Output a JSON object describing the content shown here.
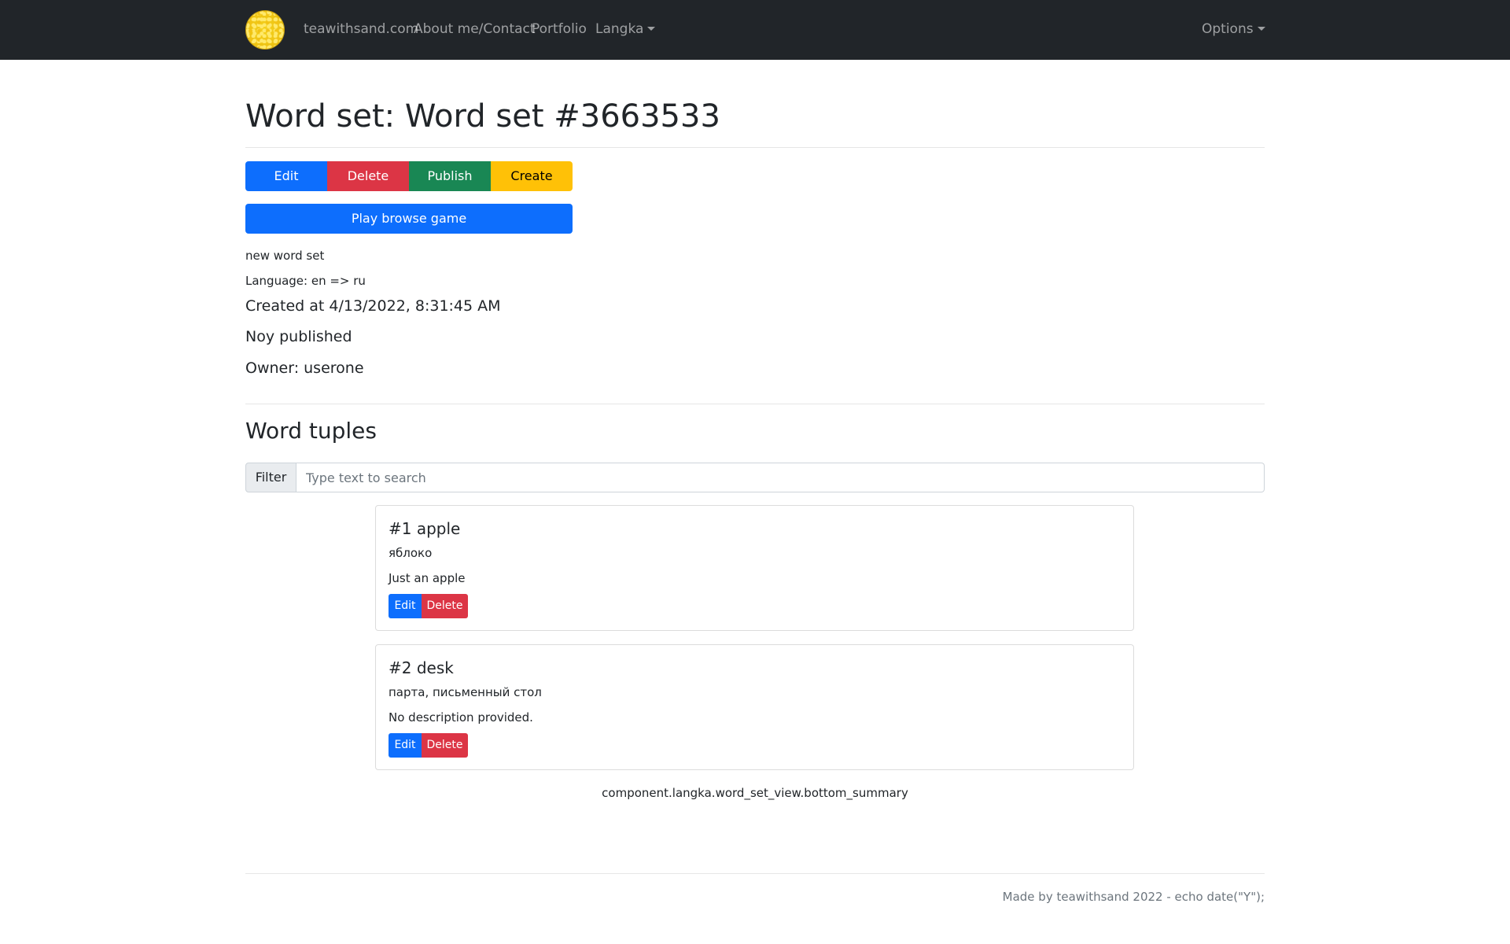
{
  "navbar": {
    "brand_icon": "sand-logo-icon",
    "links": [
      "teawithsand.com",
      "About me/Contact",
      "Portfolio"
    ],
    "dropdown_label": "Langka",
    "options_label": "Options"
  },
  "page": {
    "title": "Word set: Word set #3663533"
  },
  "actions": {
    "edit": "Edit",
    "delete": "Delete",
    "publish": "Publish",
    "create": "Create",
    "play": "Play browse game"
  },
  "info": {
    "description": "new word set",
    "language": "Language: en => ru",
    "created": "Created at 4/13/2022, 8:31:45 AM",
    "status": "Noy published",
    "owner": "Owner: userone"
  },
  "tuples": {
    "heading": "Word tuples",
    "filter_label": "Filter",
    "filter_placeholder": "Type text to search",
    "items": [
      {
        "title": "#1 apple",
        "translation": "яблоко",
        "description": "Just an apple",
        "edit": "Edit",
        "delete": "Delete"
      },
      {
        "title": "#2 desk",
        "translation": "парта, письменный стол",
        "description": "No description provided.",
        "edit": "Edit",
        "delete": "Delete"
      }
    ],
    "bottom_summary": "component.langka.word_set_view.bottom_summary"
  },
  "footer": {
    "text": "Made by teawithsand 2022 - echo date(\"Y\");"
  },
  "colors": {
    "navbar_bg": "#212529",
    "primary": "#0d6efd",
    "danger": "#dc3545",
    "success": "#198754",
    "warning": "#ffc107"
  }
}
